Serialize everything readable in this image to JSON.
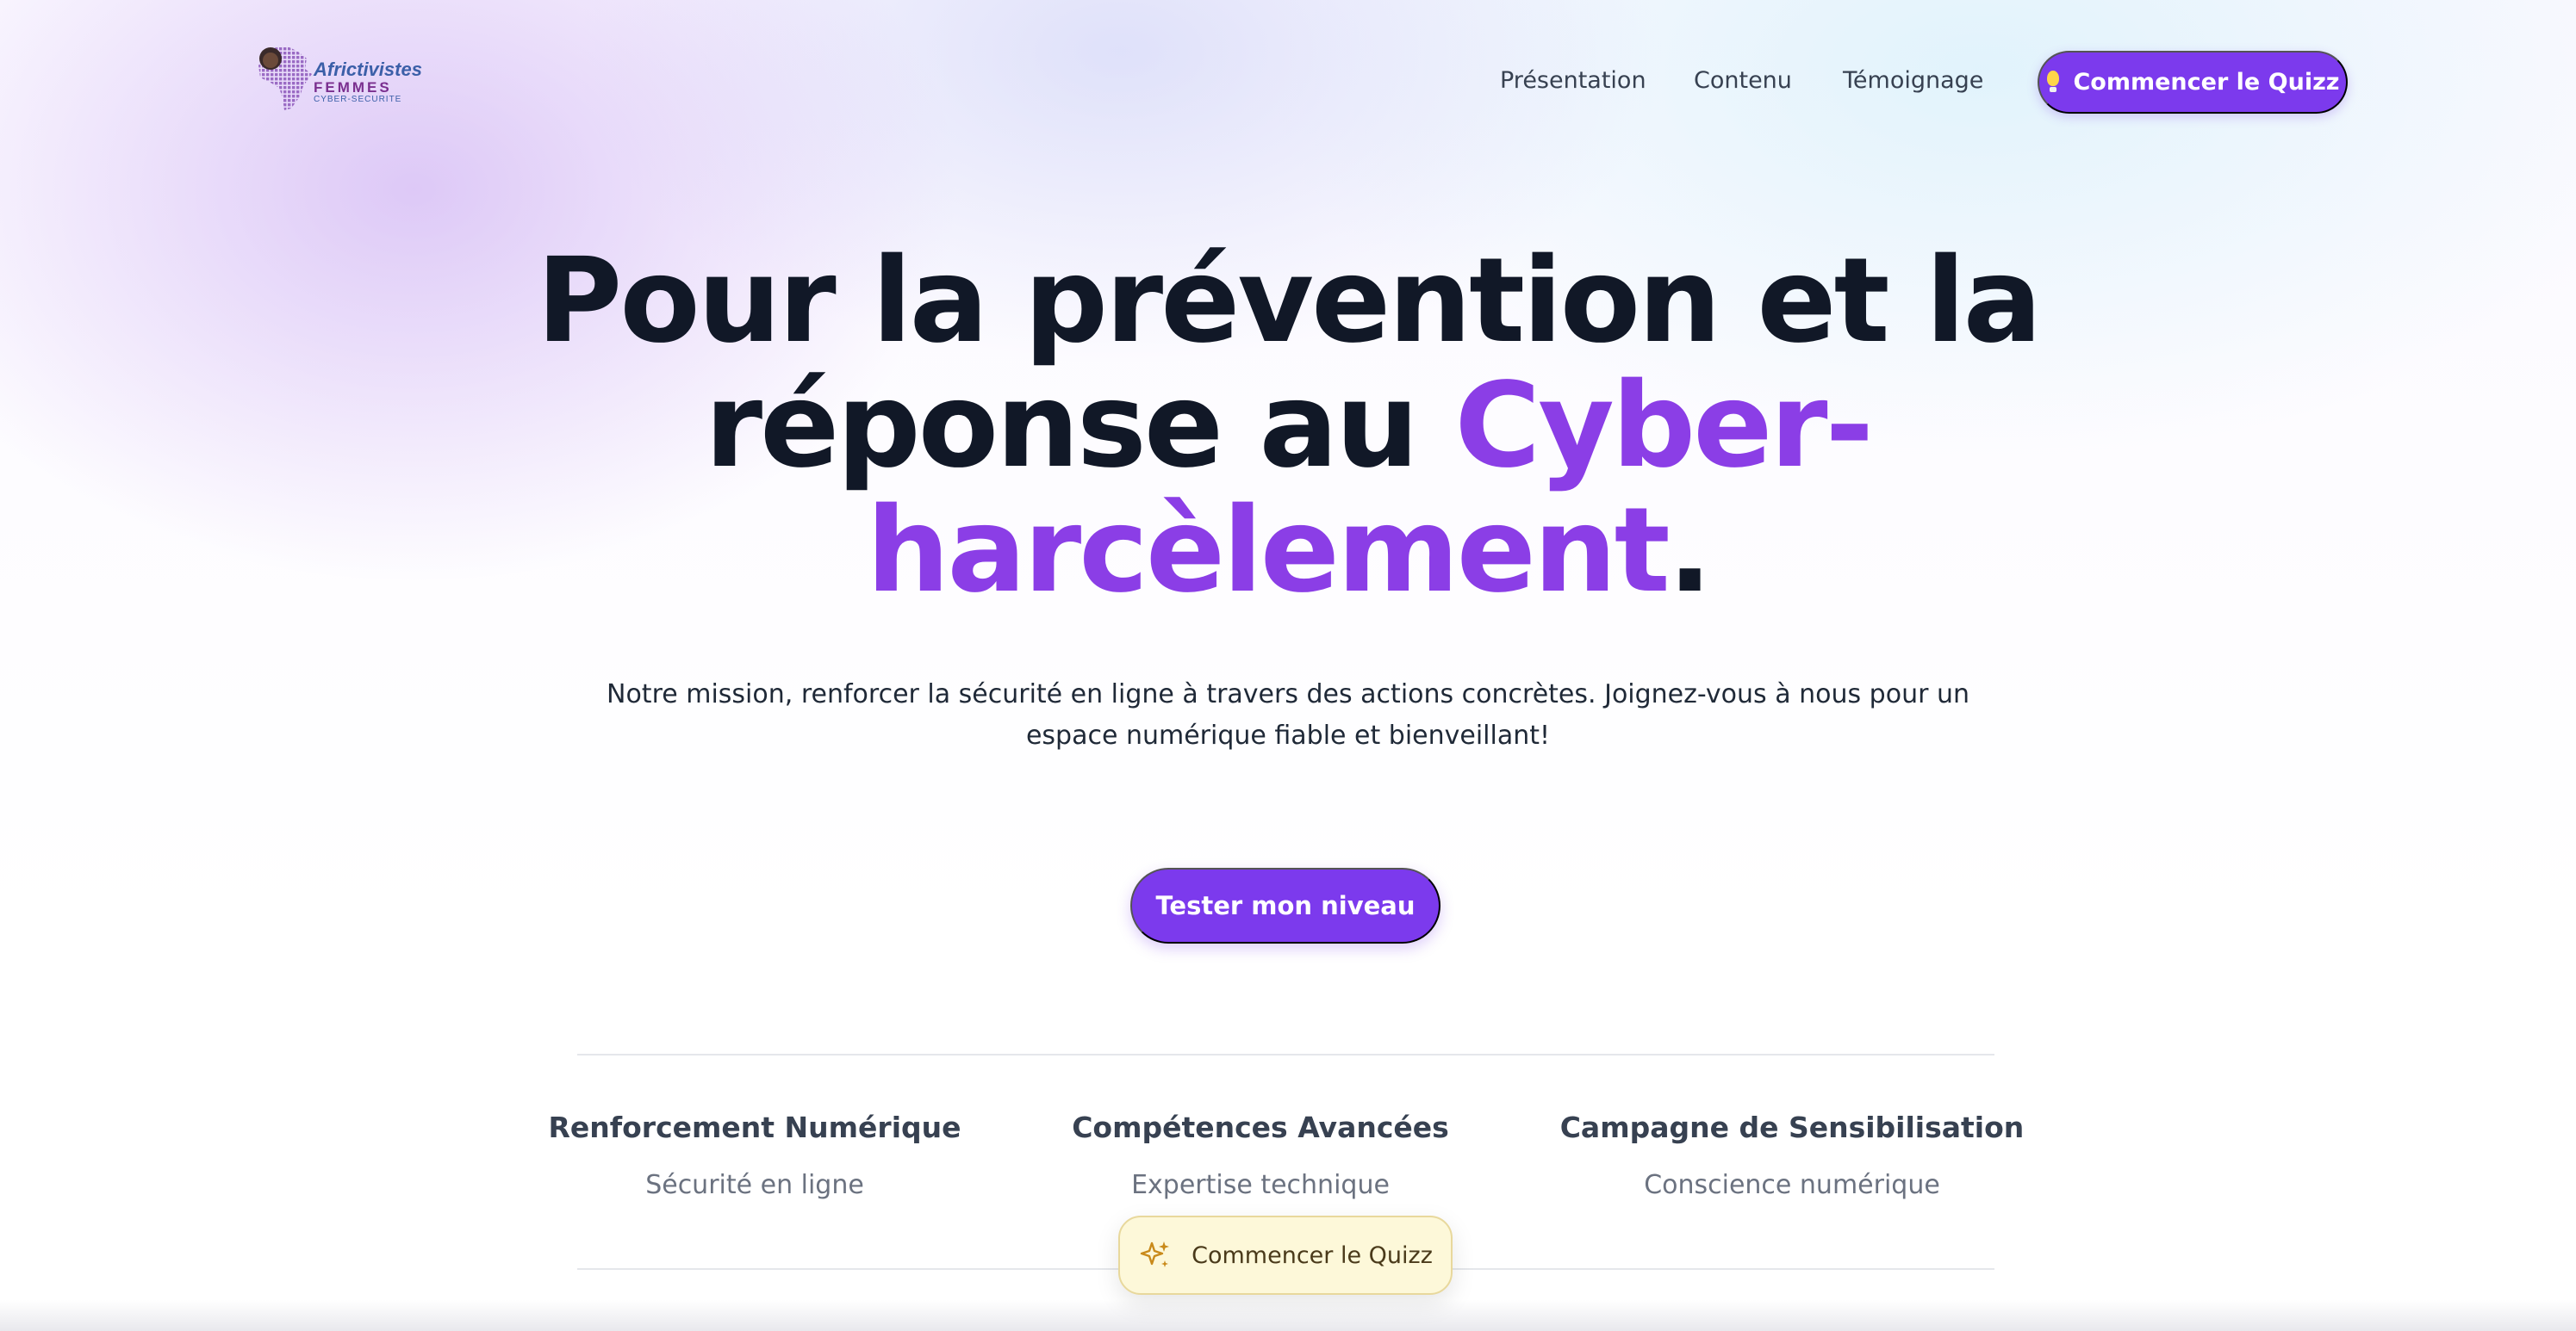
{
  "header": {
    "logo": {
      "line1": "Africtivistes",
      "line2": "FEMMES",
      "line3": "CYBER-SECURITE"
    },
    "nav": [
      {
        "label": "Présentation"
      },
      {
        "label": "Contenu"
      },
      {
        "label": "Témoignage"
      }
    ],
    "cta_label": "Commencer le Quizz",
    "cta_icon": "lightbulb-icon"
  },
  "hero": {
    "title_part1": "Pour la prévention et la réponse au ",
    "title_accent": "Cyber-harcèlement",
    "title_end": ".",
    "subtitle": "Notre mission, renforcer la sécurité en ligne à travers des actions concrètes. Joignez-vous à nous pour un espace numérique fiable et bienveillant!",
    "cta_label": "Tester mon niveau"
  },
  "stats": [
    {
      "title": "Renforcement Numérique",
      "subtitle": "Sécurité en ligne"
    },
    {
      "title": "Compétences Avancées",
      "subtitle": "Expertise technique"
    },
    {
      "title": "Campagne de Sensibilisation",
      "subtitle": "Conscience numérique"
    }
  ],
  "floating_cta": {
    "label": "Commencer le Quizz",
    "icon": "sparkles-icon"
  },
  "colors": {
    "accent": "#7c3aed",
    "accent_text": "#8b3ee6",
    "title": "#111827",
    "floating_bg": "#fdf8d9"
  }
}
